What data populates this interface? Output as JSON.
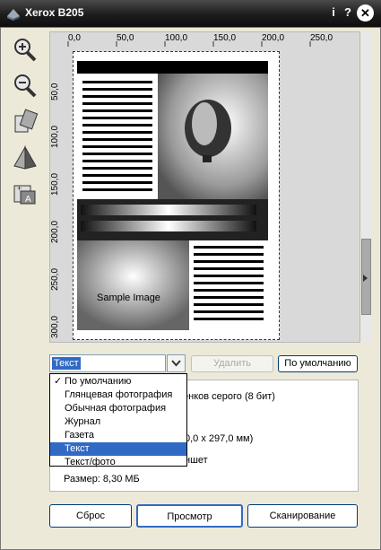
{
  "window": {
    "title": "Xerox B205"
  },
  "titlebar": {
    "help_label": "i",
    "question_label": "?"
  },
  "ruler": {
    "h_labels": [
      "0,0",
      "50,0",
      "100,0",
      "150,0",
      "200,0",
      "250,0"
    ],
    "v_labels": [
      "50,0",
      "100,0",
      "150,0",
      "200,0",
      "250,0",
      "300,0"
    ]
  },
  "preview": {
    "sample_text": "Sample Image"
  },
  "mode_select": {
    "value": "Текст",
    "options": [
      "По умолчанию",
      "Глянцевая фотография",
      "Обычная фотография",
      "Журнал",
      "Газета",
      "Текст",
      "Текст/фото"
    ],
    "checked_index": 0,
    "selected_index": 5
  },
  "buttons": {
    "delete": "Удалить",
    "default": "По умолчанию",
    "reset": "Сброс",
    "preview": "Просмотр",
    "scan": "Сканирование"
  },
  "info": {
    "color_mode_partial": "енков серого (8 бит)",
    "size_partial": "0,0 x 297,0 мм)",
    "source_partial": "ншет",
    "file_size": "Размер: 8,30 МБ"
  },
  "colors": {
    "selection": "#316ac5",
    "titlebar": "#1c1c1c",
    "accent": "#003c74"
  }
}
